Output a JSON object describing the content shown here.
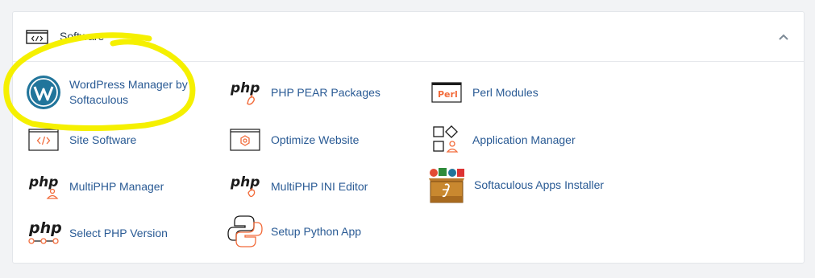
{
  "section": {
    "title": "Software",
    "collapse_icon": "chevron-up-icon"
  },
  "items": [
    {
      "label": "WordPress Manager by Softaculous",
      "icon": "wordpress-icon"
    },
    {
      "label": "PHP PEAR Packages",
      "icon": "php-pear-icon"
    },
    {
      "label": "Perl Modules",
      "icon": "perl-icon"
    },
    {
      "label": "Site Software",
      "icon": "code-window-icon"
    },
    {
      "label": "Optimize Website",
      "icon": "optimize-icon"
    },
    {
      "label": "Application Manager",
      "icon": "app-manager-icon"
    },
    {
      "label": "MultiPHP Manager",
      "icon": "php-user-icon"
    },
    {
      "label": "MultiPHP INI Editor",
      "icon": "php-ini-icon"
    },
    {
      "label": "Softaculous Apps Installer",
      "icon": "softaculous-box-icon"
    },
    {
      "label": "Select PHP Version",
      "icon": "php-version-icon"
    },
    {
      "label": "Setup Python App",
      "icon": "python-icon"
    }
  ],
  "icon_text": {
    "php": "php",
    "perl": "Perl"
  },
  "colors": {
    "link": "#295a94",
    "accent": "#f26b3a",
    "wordpress": "#21759b",
    "highlight": "#f5f000"
  }
}
